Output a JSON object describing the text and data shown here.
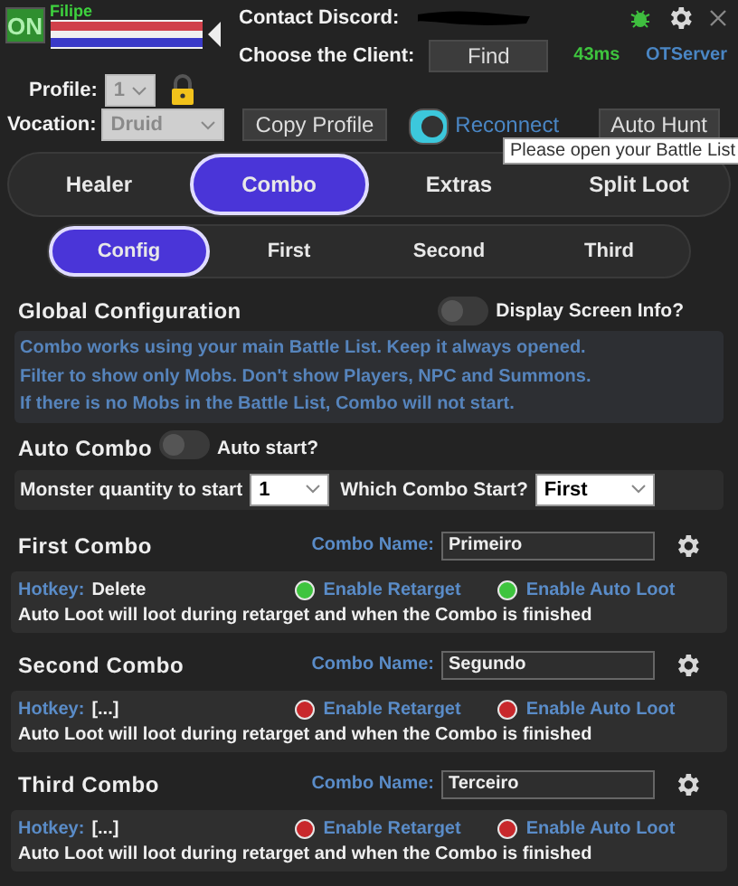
{
  "header": {
    "status_button": "ON",
    "status_on": true,
    "character": "Filipe",
    "contact_label": "Contact Discord:",
    "client_label": "Choose the Client:",
    "find_button": "Find",
    "ping": "43ms",
    "server": "OTServer"
  },
  "profile": {
    "label": "Profile:",
    "value": "1",
    "disabled": true,
    "locked": true
  },
  "vocation": {
    "label": "Vocation:",
    "value": "Druid",
    "disabled": true
  },
  "copy_button": "Copy Profile",
  "reconnect": {
    "label": "Reconnect",
    "on": true
  },
  "auto_hunt_button": "Auto Hunt",
  "tooltip": "Please open your Battle List",
  "tabs": [
    {
      "label": "Healer",
      "selected": false
    },
    {
      "label": "Combo",
      "selected": true
    },
    {
      "label": "Extras",
      "selected": false
    },
    {
      "label": "Split Loot",
      "selected": false
    }
  ],
  "subtabs": [
    {
      "label": "Config",
      "selected": true
    },
    {
      "label": "First",
      "selected": false
    },
    {
      "label": "Second",
      "selected": false
    },
    {
      "label": "Third",
      "selected": false
    }
  ],
  "global": {
    "title": "Global Configuration",
    "display_info": {
      "label": "Display Screen Info?",
      "on": false
    },
    "info_lines": [
      "Combo works using your main Battle List. Keep it always opened.",
      "Filter to show only Mobs. Don't show Players, NPC and Summons.",
      "If there is no Mobs in the Battle List, Combo will not start."
    ]
  },
  "auto_combo": {
    "title": "Auto Combo",
    "on": false,
    "label": "Auto start?"
  },
  "start": {
    "quantity_label": "Monster quantity to start",
    "quantity": "1",
    "which_label": "Which Combo Start?",
    "which": "First"
  },
  "combos": [
    {
      "title": "First Combo",
      "name_label": "Combo Name:",
      "name": "Primeiro",
      "hotkey_label": "Hotkey:",
      "hotkey": "Delete",
      "retarget": {
        "label": "Enable Retarget",
        "enabled": true
      },
      "auto_loot": {
        "label": "Enable Auto Loot",
        "enabled": true
      },
      "note": "Auto Loot will loot during retarget and when the Combo is finished"
    },
    {
      "title": "Second Combo",
      "name_label": "Combo Name:",
      "name": "Segundo",
      "hotkey_label": "Hotkey:",
      "hotkey": "[...]",
      "retarget": {
        "label": "Enable Retarget",
        "enabled": false
      },
      "auto_loot": {
        "label": "Enable Auto Loot",
        "enabled": false
      },
      "note": "Auto Loot will loot during retarget and when the Combo is finished"
    },
    {
      "title": "Third Combo",
      "name_label": "Combo Name:",
      "name": "Terceiro",
      "hotkey_label": "Hotkey:",
      "hotkey": "[...]",
      "retarget": {
        "label": "Enable Retarget",
        "enabled": false
      },
      "auto_loot": {
        "label": "Enable Auto Loot",
        "enabled": false
      },
      "note": "Auto Loot will loot during retarget and when the Combo is finished"
    }
  ]
}
